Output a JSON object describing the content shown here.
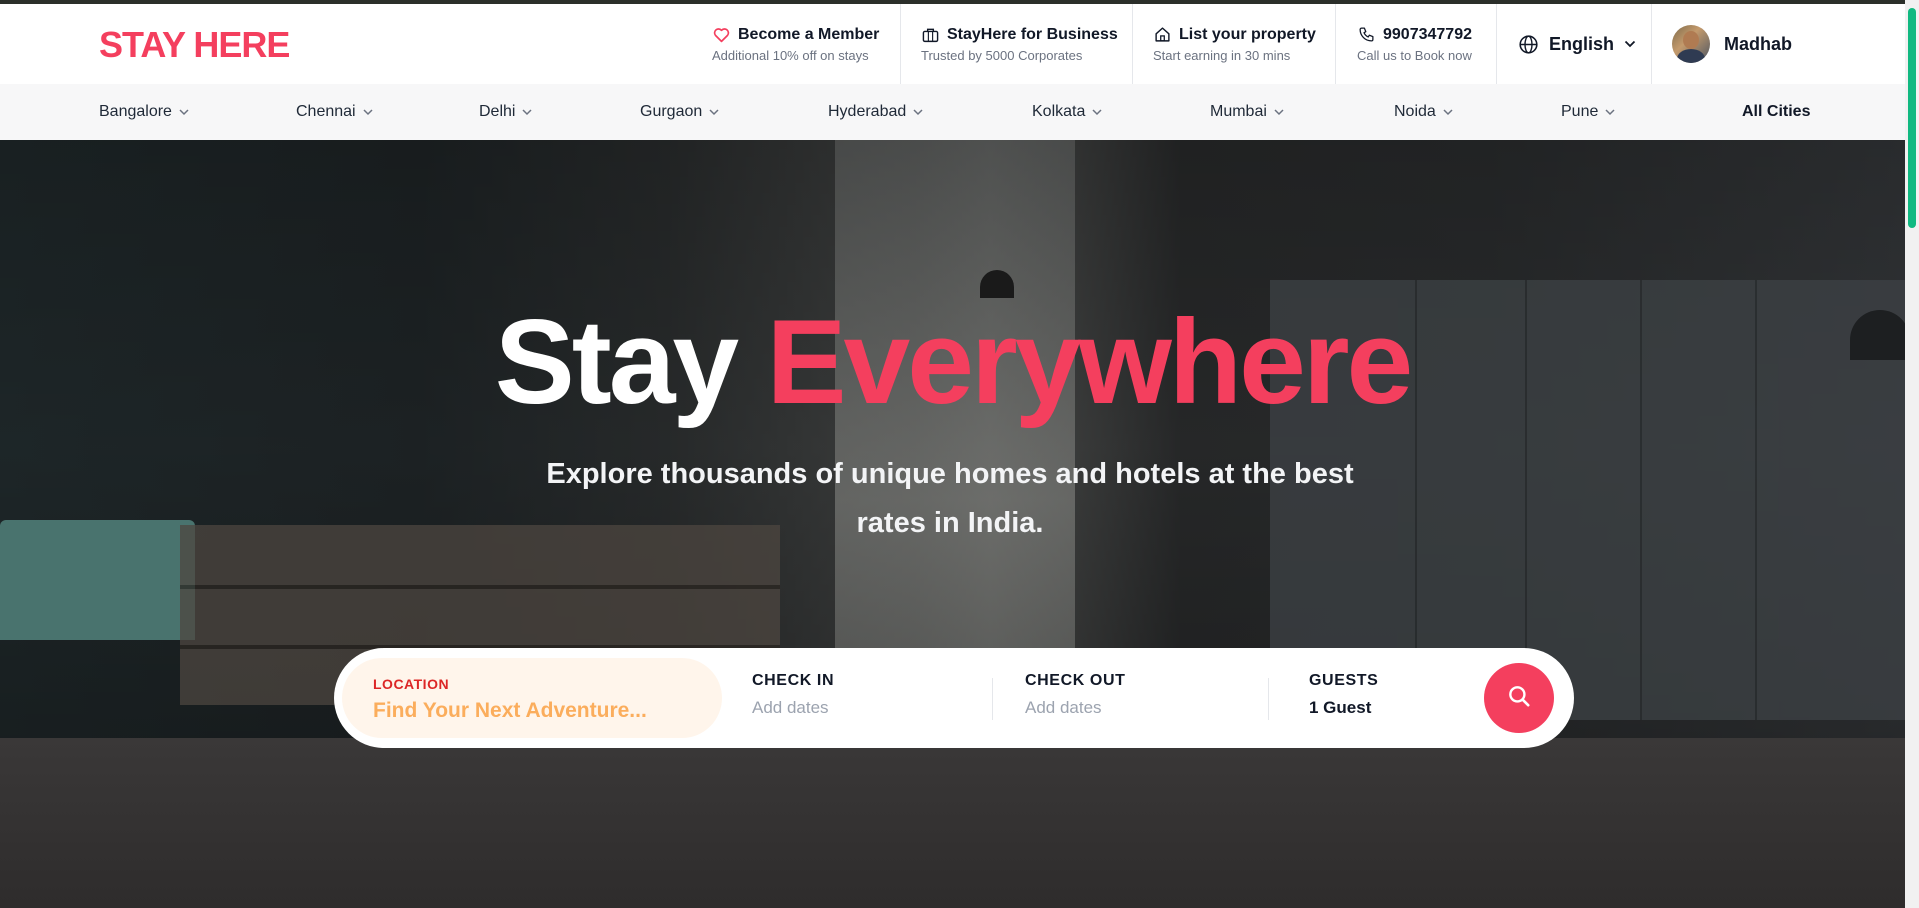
{
  "brand": {
    "logo": "STAY HERE",
    "accent": "#f43f5e"
  },
  "header": {
    "member": {
      "title": "Become a Member",
      "subtitle": "Additional 10% off on stays",
      "icon": "heart-icon"
    },
    "business": {
      "title": "StayHere for Business",
      "subtitle": "Trusted by 5000 Corporates",
      "icon": "briefcase-icon"
    },
    "property": {
      "title": "List your property",
      "subtitle": "Start earning in 30 mins",
      "icon": "home-icon"
    },
    "phone": {
      "title": "9907347792",
      "subtitle": "Call us to Book now",
      "icon": "phone-icon"
    },
    "language": {
      "label": "English",
      "icon": "globe-icon"
    },
    "user": {
      "name": "Madhab"
    }
  },
  "cities": {
    "items": [
      "Bangalore",
      "Chennai",
      "Delhi",
      "Gurgaon",
      "Hyderabad",
      "Kolkata",
      "Mumbai",
      "Noida",
      "Pune"
    ],
    "all_label": "All Cities"
  },
  "hero": {
    "title_white": "Stay",
    "title_accent": "Everywhere",
    "subtitle_line1": "Explore thousands of unique homes and hotels at the best",
    "subtitle_line2": "rates in India."
  },
  "search": {
    "location": {
      "label": "LOCATION",
      "placeholder": "Find Your Next Adventure..."
    },
    "checkin": {
      "label": "CHECK IN",
      "value": "Add dates"
    },
    "checkout": {
      "label": "CHECK OUT",
      "value": "Add dates"
    },
    "guests": {
      "label": "GUESTS",
      "value": "1 Guest"
    },
    "button_icon": "search-icon"
  }
}
